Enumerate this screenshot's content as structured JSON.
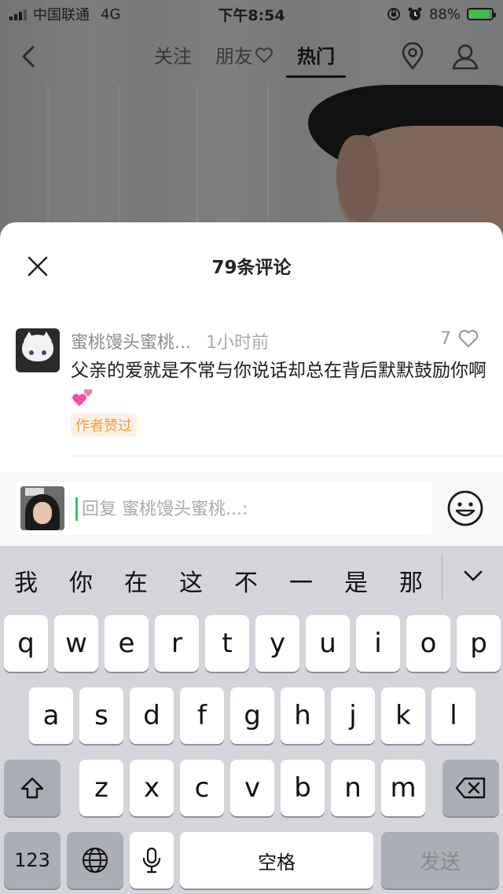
{
  "status_bar": {
    "carrier": "中国联通",
    "network": "4G",
    "time": "下午8:54",
    "battery_percent": "88%",
    "battery_level": 0.88,
    "battery_color": "#39c341",
    "icons": [
      "signal-icon",
      "rotation-lock-icon",
      "alarm-icon",
      "battery-charging-icon"
    ]
  },
  "top_nav": {
    "tabs": [
      {
        "label": "关注"
      },
      {
        "label": "朋友"
      },
      {
        "label": "热门"
      }
    ],
    "active_tab": "热门",
    "icons": [
      "back-icon",
      "heart-outline-icon",
      "location-pin-icon",
      "profile-icon"
    ]
  },
  "comments": {
    "title": "79条评论",
    "items": [
      {
        "username": "蜜桃馒头蜜桃...",
        "time": "1小时前",
        "likes": "7",
        "text": "父亲的爱就是不常与你说话却总在背后默默鼓励你啊",
        "emoji": "two-hearts-emoji",
        "badge": "作者赞过"
      }
    ]
  },
  "reply": {
    "placeholder": "回复 蜜桃馒头蜜桃...:",
    "value": ""
  },
  "keyboard": {
    "candidates": [
      "我",
      "你",
      "在",
      "这",
      "不",
      "一",
      "是",
      "那"
    ],
    "row1": [
      "q",
      "w",
      "e",
      "r",
      "t",
      "y",
      "u",
      "i",
      "o",
      "p"
    ],
    "row2": [
      "a",
      "s",
      "d",
      "f",
      "g",
      "h",
      "j",
      "k",
      "l"
    ],
    "row3": [
      "z",
      "x",
      "c",
      "v",
      "b",
      "n",
      "m"
    ],
    "numbers_label": "123",
    "space_label": "空格",
    "send_label": "发送"
  },
  "colors": {
    "accent_badge": "#e8a04a",
    "caret": "#3cc06a",
    "keyboard_bg": "#d3d5db"
  }
}
